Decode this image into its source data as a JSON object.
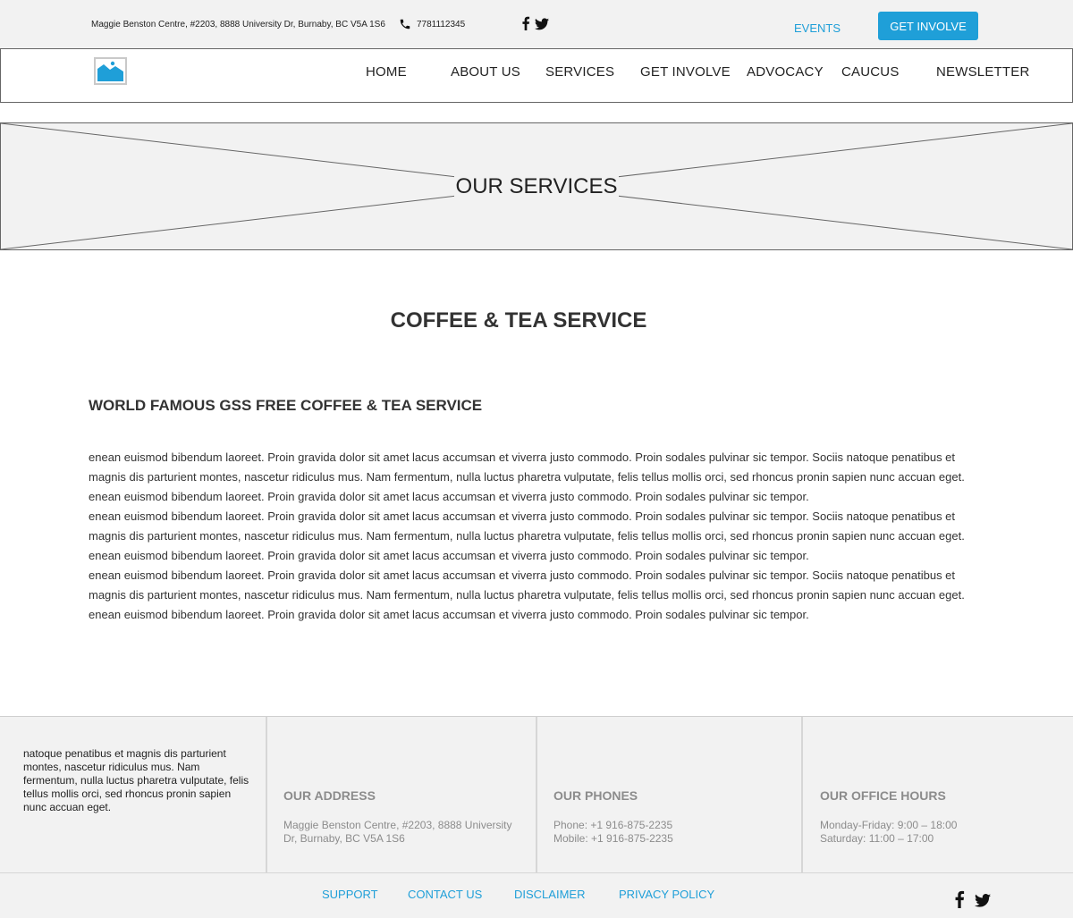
{
  "topbar": {
    "address": "Maggie Benston Centre, #2203, 8888 University Dr, Burnaby, BC V5A 1S6",
    "phone": "7781112345",
    "events_label": "EVENTS",
    "cta_label": "GET INVOLVE"
  },
  "nav": {
    "items": [
      {
        "label": "HOME"
      },
      {
        "label": "ABOUT US"
      },
      {
        "label": "SERVICES"
      },
      {
        "label": "GET INVOLVE"
      },
      {
        "label": "ADVOCACY"
      },
      {
        "label": "CAUCUS"
      },
      {
        "label": "NEWSLETTER"
      }
    ]
  },
  "hero": {
    "title": "OUR SERVICES"
  },
  "main": {
    "title": "COFFEE & TEA SERVICE",
    "subtitle": "WORLD FAMOUS GSS FREE COFFEE & TEA SERVICE",
    "paragraphs": [
      "enean euismod bibendum laoreet. Proin gravida dolor sit amet lacus accumsan et viverra justo commodo. Proin sodales pulvinar sic tempor. Sociis natoque penatibus et magnis dis parturient montes, nascetur ridiculus mus. Nam fermentum, nulla luctus pharetra vulputate, felis tellus mollis orci, sed rhoncus pronin sapien nunc accuan eget. enean euismod bibendum laoreet. Proin gravida dolor sit amet lacus accumsan et viverra justo commodo. Proin sodales pulvinar sic tempor.",
      "enean euismod bibendum laoreet. Proin gravida dolor sit amet lacus accumsan et viverra justo commodo. Proin sodales pulvinar sic tempor. Sociis natoque penatibus et magnis dis parturient montes, nascetur ridiculus mus. Nam fermentum, nulla luctus pharetra vulputate, felis tellus mollis orci, sed rhoncus pronin sapien nunc accuan eget. enean euismod bibendum laoreet. Proin gravida dolor sit amet lacus accumsan et viverra justo commodo. Proin sodales pulvinar sic tempor.",
      "enean euismod bibendum laoreet. Proin gravida dolor sit amet lacus accumsan et viverra justo commodo. Proin sodales pulvinar sic tempor. Sociis natoque penatibus et magnis dis parturient montes, nascetur ridiculus mus. Nam fermentum, nulla luctus pharetra vulputate, felis tellus mollis orci, sed rhoncus pronin sapien nunc accuan eget. enean euismod bibendum laoreet. Proin gravida dolor sit amet lacus accumsan et viverra justo commodo. Proin sodales pulvinar sic tempor."
    ]
  },
  "footer": {
    "intro": "natoque penatibus et magnis dis parturient montes, nascetur ridiculus mus. Nam fermentum, nulla luctus pharetra vulputate, felis tellus mollis orci, sed rhoncus pronin sapien nunc accuan eget.",
    "address_heading": "OUR ADDRESS",
    "address_line1": "Maggie Benston Centre, #2203, 8888 University",
    "address_line2": "Dr, Burnaby, BC V5A 1S6",
    "phones_heading": "OUR PHONES",
    "phone_line": "Phone: +1 916-875-2235",
    "mobile_line": "Mobile: +1 916-875-2235",
    "hours_heading": "OUR OFFICE HOURS",
    "hours_weekday": "Monday-Friday: 9:00 – 18:00",
    "hours_saturday": "Saturday: 11:00 – 17:00"
  },
  "bottombar": {
    "links": [
      {
        "label": "SUPPORT"
      },
      {
        "label": "CONTACT US"
      },
      {
        "label": "DISCLAIMER"
      },
      {
        "label": "PRIVACY POLICY"
      }
    ]
  },
  "colors": {
    "accent": "#1f9fd8",
    "panel_bg": "#f2f2f2",
    "muted_text": "#8c8c8c"
  },
  "icons": {
    "phone": "phone-icon",
    "facebook": "facebook-icon",
    "twitter": "twitter-icon",
    "logo": "image-placeholder-icon"
  }
}
